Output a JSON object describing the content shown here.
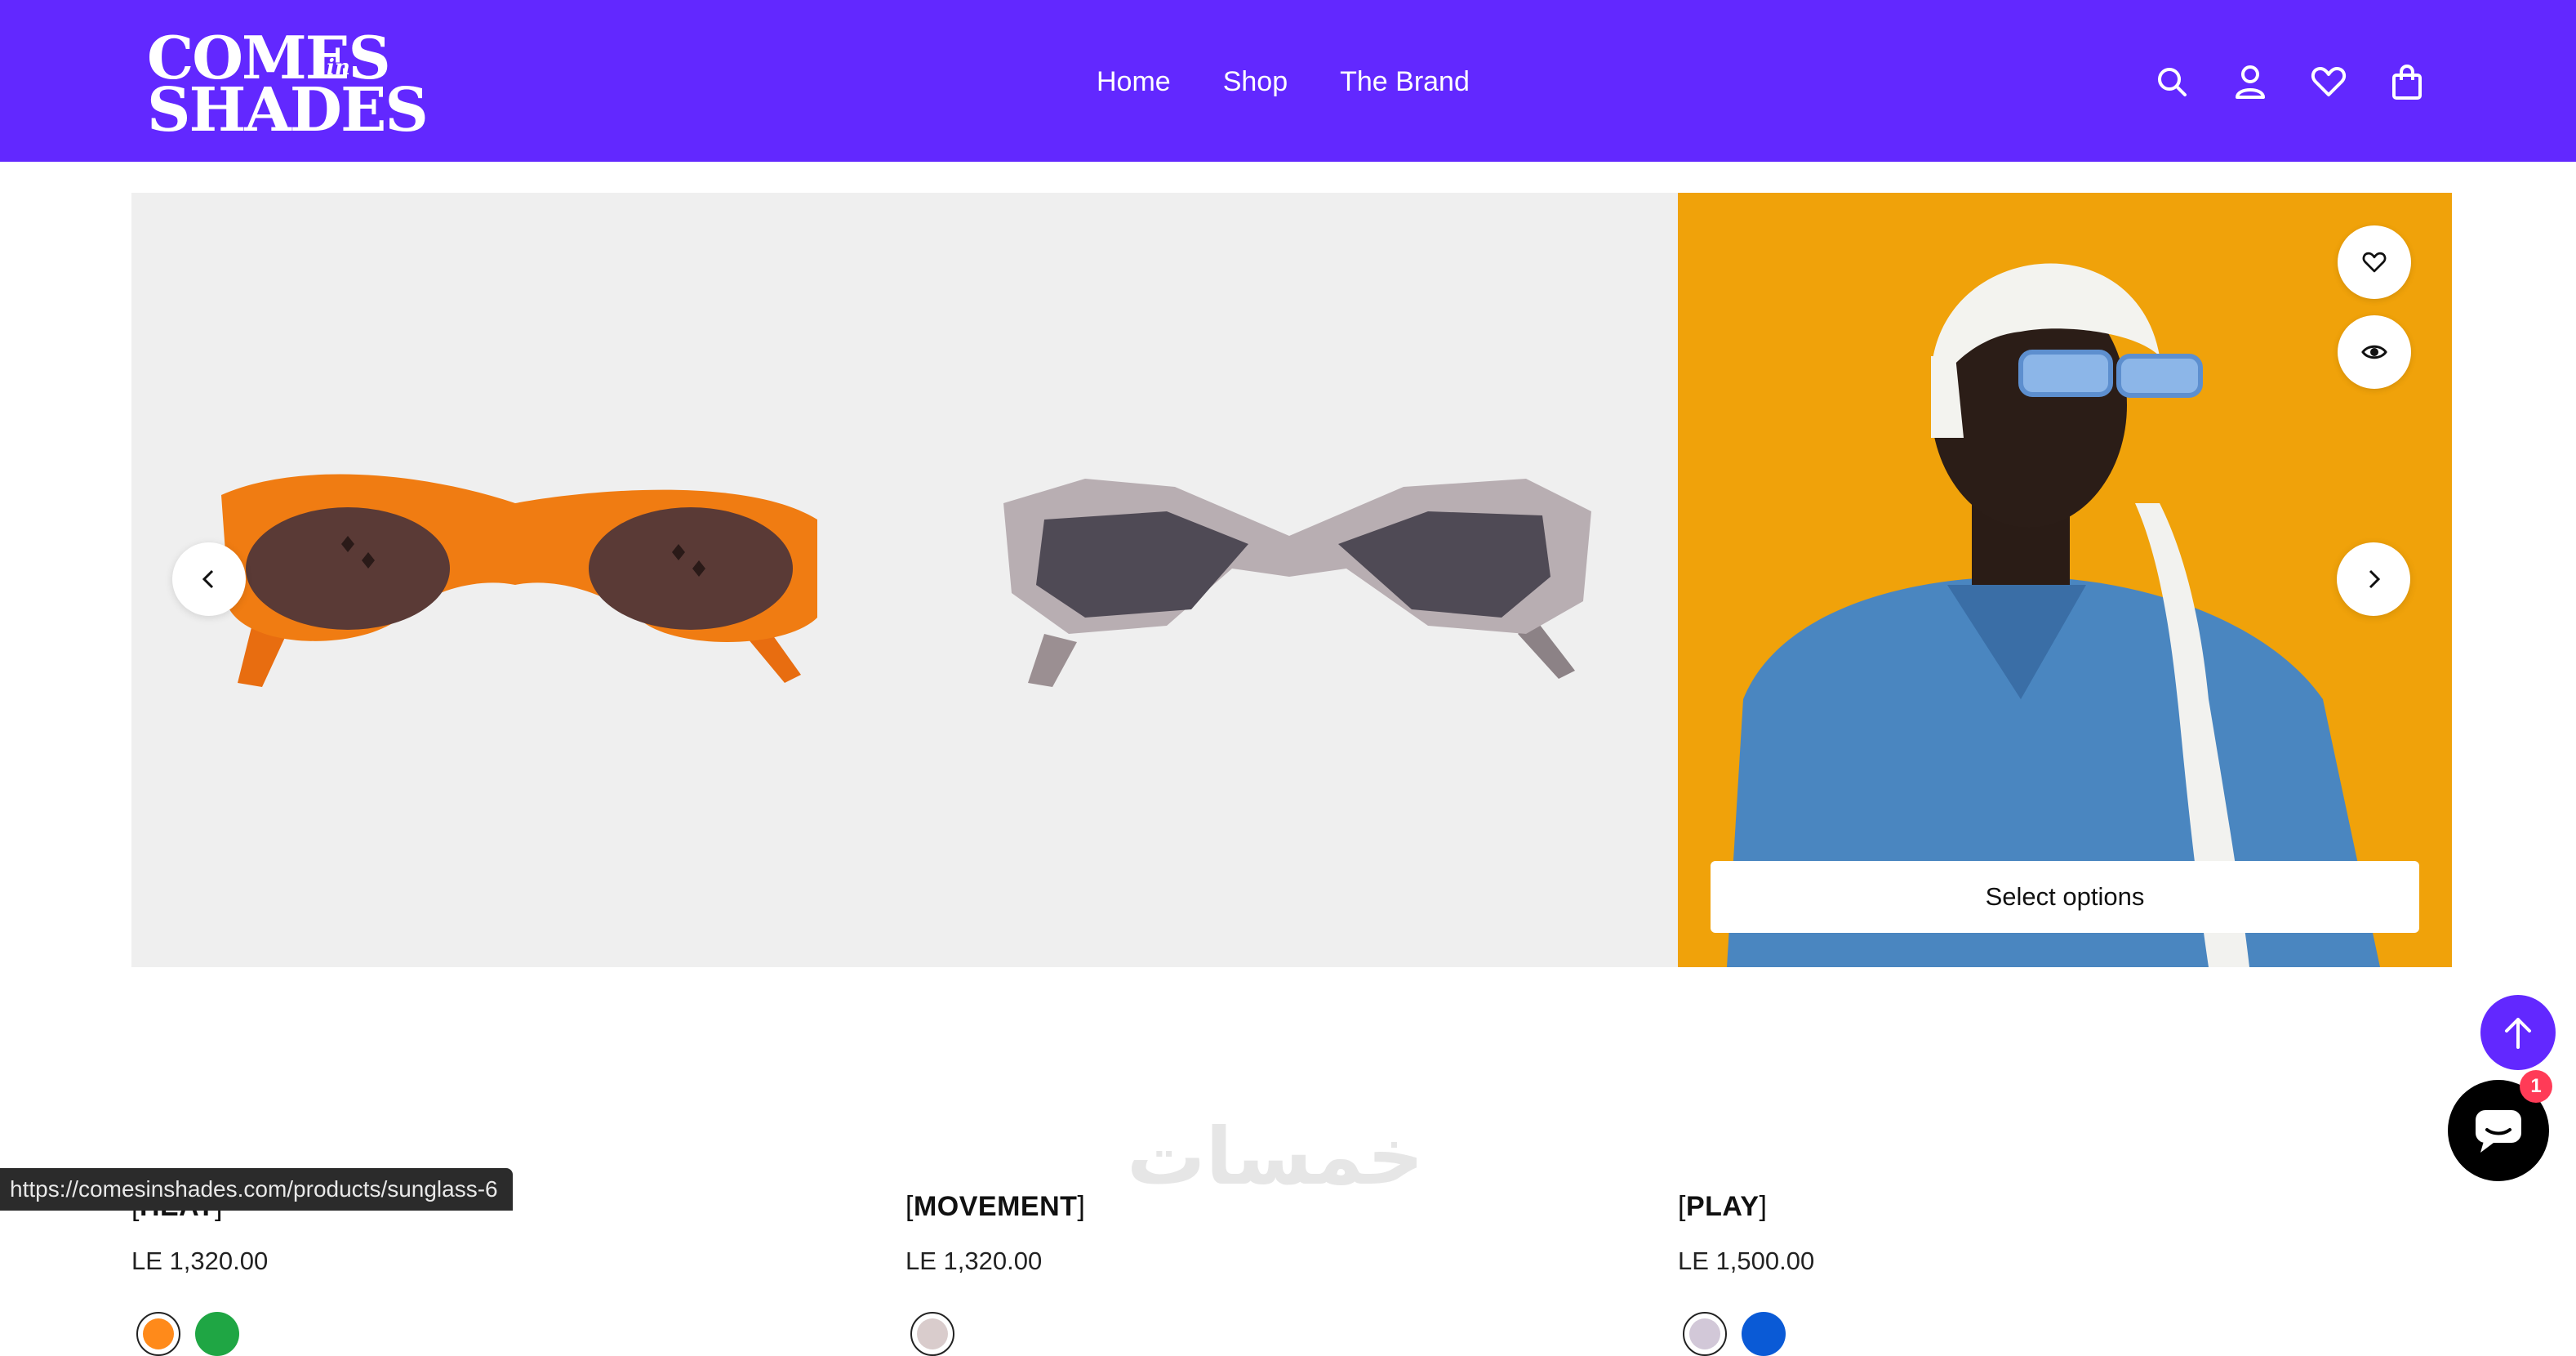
{
  "header": {
    "logo": {
      "line1": "COMES",
      "in": "in",
      "line2": "SHADES"
    },
    "nav": [
      "Home",
      "Shop",
      "The Brand"
    ],
    "icons": [
      "search-icon",
      "account-icon",
      "wishlist-heart-icon",
      "cart-bag-icon"
    ]
  },
  "products": [
    {
      "name": "HEAT",
      "bracket_open": "[",
      "bracket_close": "]",
      "price": "LE 1,320.00",
      "swatches": [
        "#ff8a1a",
        "#1fa644"
      ]
    },
    {
      "name": "MOVEMENT",
      "bracket_open": "[",
      "bracket_close": "]",
      "price": "LE 1,320.00",
      "swatches": [
        "#d9cccc"
      ]
    },
    {
      "name": "PLAY",
      "bracket_open": "[",
      "bracket_close": "]",
      "price": "LE 1,500.00",
      "swatches": [
        "#d2c8d8",
        "#0a5ad6"
      ],
      "select_label": "Select options"
    }
  ],
  "carousel": {
    "prev": "chevron-left-icon",
    "next": "chevron-right-icon"
  },
  "chat": {
    "badge": "1"
  },
  "status_url": "https://comesinshades.com/products/sunglass-6",
  "watermark": "خمسات",
  "colors": {
    "header_bg": "#6228ff",
    "image_bg": "#efefef",
    "play_bg": "#f0a20a"
  }
}
